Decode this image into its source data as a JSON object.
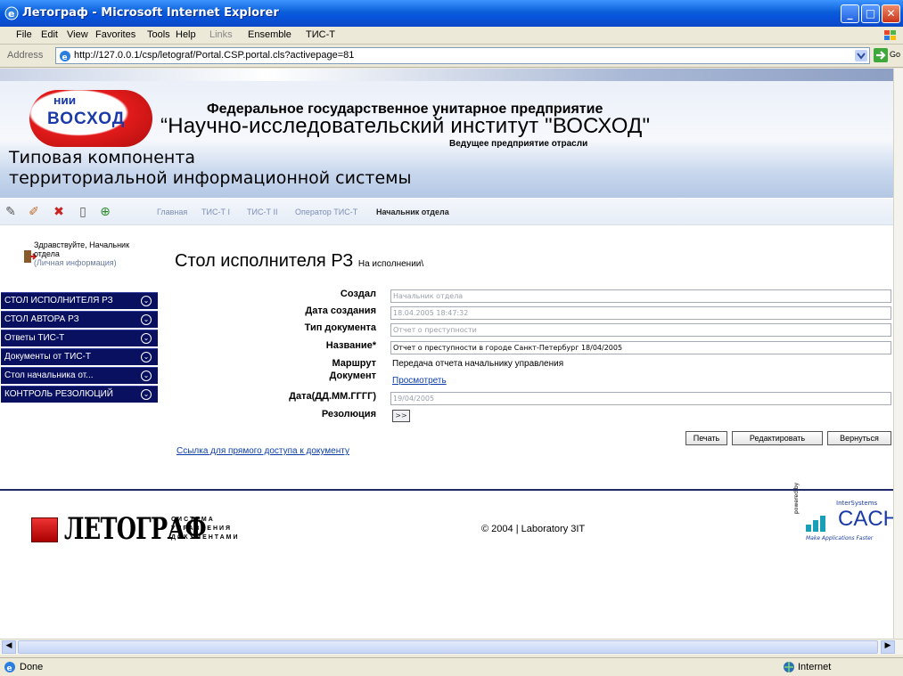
{
  "window": {
    "title": "Летограф - Microsoft Internet Explorer"
  },
  "menubar": {
    "items": [
      "File",
      "Edit",
      "View",
      "Favorites",
      "Tools",
      "Help"
    ],
    "links_label": "Links",
    "link1": "Ensemble",
    "link2": "ТИС-Т"
  },
  "address": {
    "label": "Address",
    "url": "http://127.0.0.1/csp/letograf/Portal.CSP.portal.cls?activepage=81",
    "go": "Go"
  },
  "banner": {
    "logo_small": "НИИ",
    "logo_big": "ВОСХОД",
    "org_line1": "Федеральное государственное унитарное предприятие",
    "org_line2": "“Научно-исследовательский институт \"ВОСХОД\"",
    "org_line3": "Ведущее предприятие отрасли",
    "tk_line1": "Типовая компонента",
    "tk_line2": "территориальной информационной системы"
  },
  "nav": {
    "links": [
      "Главная",
      "ТИС-Т I",
      "ТИС-Т II",
      "Оператор ТИС-Т",
      "Начальник отдела"
    ]
  },
  "greeting": {
    "line1": "Здравствуйте, Начальник",
    "line2": "отдела",
    "line3": "(Личная информация)"
  },
  "sidemenu": [
    "СТОЛ ИСПОЛНИТЕЛЯ РЗ",
    "СТОЛ АВТОРА РЗ",
    "Ответы ТИС-Т",
    "Документы от ТИС-Т",
    "Стол начальника от...",
    "КОНТРОЛЬ РЕЗОЛЮЦИЙ"
  ],
  "main": {
    "title": "Стол исполнителя РЗ",
    "subtitle": "На исполнении\\",
    "labels": {
      "created_by": "Создал",
      "created_date": "Дата создания",
      "doc_type": "Тип документа",
      "name": "Название*",
      "route": "Маршрут",
      "document": "Документ",
      "date": "Дата(ДД.ММ.ГГГГ)",
      "resolution": "Резолюция"
    },
    "values": {
      "created_by": "Начальник отдела",
      "created_date": "18.04.2005 18:47:32",
      "doc_type": "Отчет о преступности",
      "name": "Отчет о преступности в городе Санкт-Петербург  18/04/2005",
      "route": "Передача отчета начальнику управления",
      "document": "Просмотреть",
      "date": "19/04/2005",
      "resolution_btn": ">>"
    },
    "direct_link": "Ссылка для прямого доступа к документу",
    "buttons": {
      "print": "Печать",
      "edit": "Редактировать",
      "back": "Вернуться"
    }
  },
  "footer": {
    "brand": "ЛЕТОГРАФ",
    "sys1": "СИСТЕМА",
    "sys2": "УПРАВЛЕНИЯ",
    "sys3": "ДОКУМЕНТАМИ",
    "copyright": "© 2004 | Laboratory 3IT",
    "powered": "powered by",
    "intersystems": "InterSystems",
    "cache": "CACHÉ",
    "cache_tag": "Make Applications Faster"
  },
  "status": {
    "left": "Done",
    "zone": "Internet"
  }
}
